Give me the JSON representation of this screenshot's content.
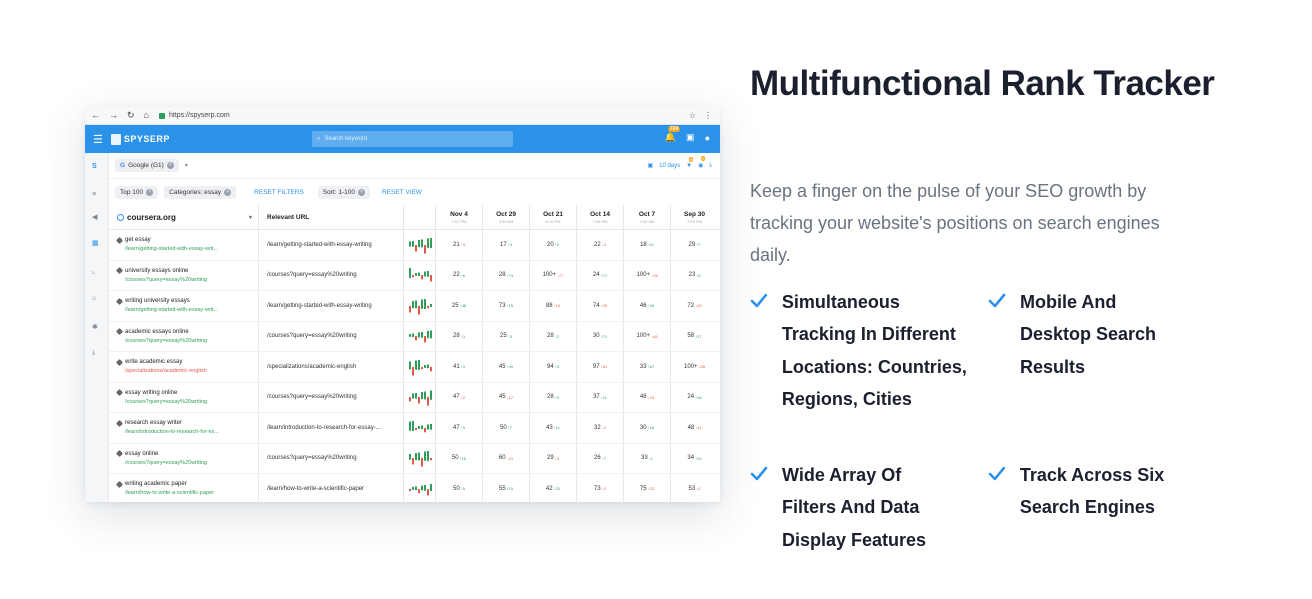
{
  "browser": {
    "url": "https://spyserp.com"
  },
  "app": {
    "logo": "SPYSERP",
    "search_placeholder": "Search keyword",
    "notifications_count": "724",
    "engine": "Google (G1)",
    "period": "10 days",
    "filter_badge": "9",
    "view_badge": "9"
  },
  "filters": {
    "chips": [
      "Top 100",
      "Categories: essay"
    ],
    "reset_filters": "RESET FILTERS",
    "sort_chip": "Sort: 1-100",
    "reset_view": "RESET VIEW"
  },
  "table": {
    "domain": "coursera.org",
    "url_header": "Relevant URL",
    "dates": [
      {
        "d": "Nov 4",
        "t": "7:07 PM"
      },
      {
        "d": "Oct 29",
        "t": "3:59 AM"
      },
      {
        "d": "Oct 21",
        "t": "8:15 PM"
      },
      {
        "d": "Oct 14",
        "t": "7:06 PM"
      },
      {
        "d": "Oct 7",
        "t": "7:00 AM"
      },
      {
        "d": "Sep 30",
        "t": "7:00 PM"
      }
    ],
    "rows": [
      {
        "kw": "get essay",
        "kurl": "/learn/getting-started-with-essay-writ...",
        "kcolor": "green",
        "url": "/learn/getting-started-with-essay-writing",
        "vals": [
          [
            "21",
            "↓4",
            "down"
          ],
          [
            "17",
            "↑3",
            "up"
          ],
          [
            "20",
            "↑2",
            "up"
          ],
          [
            "22",
            "↓4",
            "down"
          ],
          [
            "18",
            "↑11",
            "up"
          ],
          [
            "29",
            "↑7",
            "up"
          ]
        ]
      },
      {
        "kw": "university essays online",
        "kurl": "/courses?query=essay%20writing",
        "kcolor": "green",
        "url": "/courses?query=essay%20writing",
        "vals": [
          [
            "22",
            "↑6",
            "up"
          ],
          [
            "28",
            "↑73",
            "up"
          ],
          [
            "100+",
            "↓77",
            "down"
          ],
          [
            "24",
            "↑77",
            "up"
          ],
          [
            "100+",
            "↓78",
            "down"
          ],
          [
            "23",
            "↑9",
            "up"
          ]
        ]
      },
      {
        "kw": "writing university essays",
        "kurl": "/learn/getting-started-with-essay-writ...",
        "kcolor": "green",
        "url": "/learn/getting-started-with-essay-writing",
        "vals": [
          [
            "25",
            "↑48",
            "up"
          ],
          [
            "73",
            "↑15",
            "up"
          ],
          [
            "88",
            "↓14",
            "down"
          ],
          [
            "74",
            "↓29",
            "down"
          ],
          [
            "46",
            "↑26",
            "up"
          ],
          [
            "72",
            "↓33",
            "down"
          ]
        ]
      },
      {
        "kw": "academic essays online",
        "kurl": "/courses?query=essay%20writing",
        "kcolor": "green",
        "url": "/courses?query=essay%20writing",
        "vals": [
          [
            "28",
            "↑3",
            "up"
          ],
          [
            "25",
            "↑3",
            "up"
          ],
          [
            "28",
            "↑2",
            "up"
          ],
          [
            "30",
            "↑71",
            "up"
          ],
          [
            "100+",
            "↓45",
            "down"
          ],
          [
            "58",
            "↑27",
            "up"
          ]
        ]
      },
      {
        "kw": "write academic essay",
        "kurl": "/specializations/academic-english",
        "kcolor": "red",
        "url": "/specializations/academic-english",
        "vals": [
          [
            "41",
            "↑4",
            "up"
          ],
          [
            "45",
            "↑49",
            "up"
          ],
          [
            "94",
            "↑3",
            "up"
          ],
          [
            "97",
            "↓64",
            "down"
          ],
          [
            "33",
            "↑67",
            "up"
          ],
          [
            "100+",
            "↓35",
            "down"
          ]
        ]
      },
      {
        "kw": "essay writing online",
        "kurl": "/courses?query=essay%20writing",
        "kcolor": "green",
        "url": "/courses?query=essay%20writing",
        "vals": [
          [
            "47",
            "↓2",
            "down"
          ],
          [
            "45",
            "↓17",
            "down"
          ],
          [
            "28",
            "↑9",
            "up"
          ],
          [
            "37",
            "↑11",
            "up"
          ],
          [
            "48",
            "↓24",
            "down"
          ],
          [
            "24",
            "↑18",
            "up"
          ]
        ]
      },
      {
        "kw": "research essay writer",
        "kurl": "/learn/introduction-to-research-for-es...",
        "kcolor": "green",
        "url": "/learn/introduction-to-research-for-essay-...",
        "vals": [
          [
            "47",
            "↑3",
            "up"
          ],
          [
            "50",
            "↑7",
            "up"
          ],
          [
            "43",
            "↑11",
            "up"
          ],
          [
            "32",
            "↓2",
            "down"
          ],
          [
            "30",
            "↑18",
            "up"
          ],
          [
            "48",
            "↓11",
            "down"
          ]
        ]
      },
      {
        "kw": "essay online",
        "kurl": "/courses?query=essay%20writing",
        "kcolor": "green",
        "url": "/courses?query=essay%20writing",
        "vals": [
          [
            "50",
            "↑16",
            "up"
          ],
          [
            "60",
            "↓21",
            "down"
          ],
          [
            "29",
            "↓3",
            "down"
          ],
          [
            "26",
            "↑7",
            "up"
          ],
          [
            "33",
            "↑1",
            "up"
          ],
          [
            "34",
            "↑10",
            "up"
          ]
        ]
      },
      {
        "kw": "writing academic paper",
        "kurl": "/learn/how-to-write-a-scientific-paper",
        "kcolor": "green",
        "url": "/learn/how-to-write-a-scientific-paper",
        "vals": [
          [
            "50",
            "↑5",
            "up"
          ],
          [
            "55",
            "↑15",
            "up"
          ],
          [
            "42",
            "↑31",
            "up"
          ],
          [
            "73",
            "↓2",
            "down"
          ],
          [
            "75",
            "↓22",
            "down"
          ],
          [
            "53",
            "↓2",
            "down"
          ]
        ]
      }
    ]
  },
  "content": {
    "title": "Multifunctional Rank Tracker",
    "description": "Keep a finger on the pulse of your SEO growth by tracking your website's positions on search engines daily.",
    "features": [
      "Simultaneous Tracking In Different Locations: Countries, Regions, Cities",
      "Mobile And Desktop Search Results",
      "Wide Array Of Filters And Data Display Features",
      "Track Across Six Search Engines"
    ],
    "check_color": "#2b92ea"
  }
}
